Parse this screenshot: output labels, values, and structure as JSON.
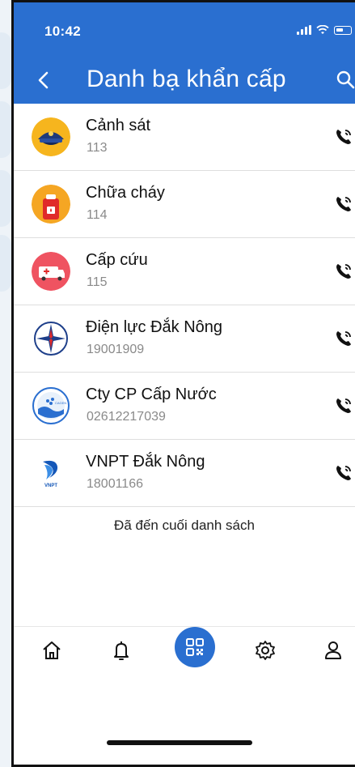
{
  "status_bar": {
    "time": "10:42"
  },
  "header": {
    "title": "Danh bạ khẩn cấp"
  },
  "contacts": [
    {
      "name": "Cảnh sát",
      "phone": "113",
      "icon": "police-icon"
    },
    {
      "name": "Chữa cháy",
      "phone": "114",
      "icon": "fire-extinguisher-icon"
    },
    {
      "name": "Cấp cứu",
      "phone": "115",
      "icon": "ambulance-icon"
    },
    {
      "name": "Điện lực Đắk Nông",
      "phone": "19001909",
      "icon": "evn-logo-icon"
    },
    {
      "name": "Cty CP Cấp Nước",
      "phone": "02612217039",
      "icon": "water-company-logo-icon"
    },
    {
      "name": "VNPT Đắk Nông",
      "phone": "18001166",
      "icon": "vnpt-logo-icon"
    }
  ],
  "end_note": "Đã đến cuối danh sách",
  "bottom_nav": [
    "home-icon",
    "bell-icon",
    "qr-code-icon",
    "gear-icon",
    "user-icon"
  ],
  "logo_text": {
    "vnpt": "VNPT",
    "water": "CAGEN"
  },
  "colors": {
    "primary": "#2a6fd0",
    "divider": "#dedede"
  }
}
